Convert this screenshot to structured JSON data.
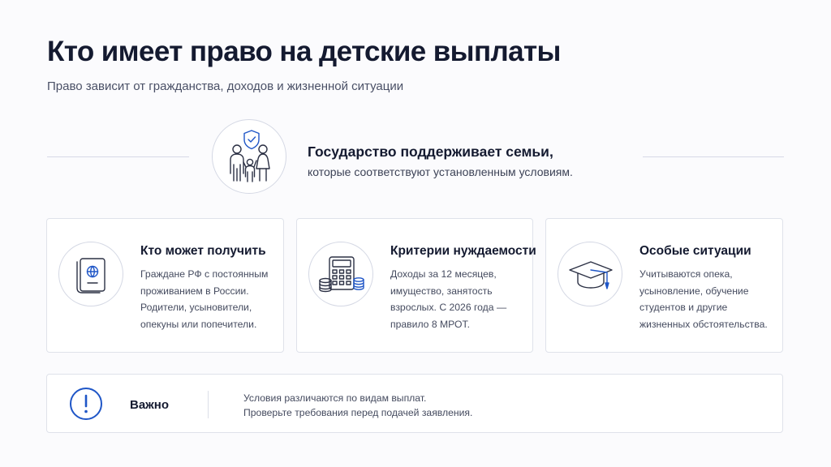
{
  "header": {
    "title": "Кто имеет право на детские выплаты",
    "subtitle": "Право зависит от гражданства, доходов и жизненной ситуации"
  },
  "hero": {
    "icon": "family-shield-icon",
    "title": "Государство поддерживает семьи,",
    "text": "которые соответствуют установленным условиям."
  },
  "cards": [
    {
      "icon": "passport-icon",
      "title": "Кто может получить",
      "lines": [
        "Граждане РФ с постоянным",
        "проживанием в России.",
        "Родители, усыновители,",
        "опекуны или попечители."
      ]
    },
    {
      "icon": "calculator-coins-icon",
      "title": "Критерии нуждаемости",
      "lines": [
        "Доходы за 12 месяцев,",
        "имущество, занятость",
        "взрослых. С 2026 года —",
        "правило 8 МРОТ."
      ]
    },
    {
      "icon": "graduation-cap-icon",
      "title": "Особые ситуации",
      "lines": [
        "Учитываются опека,",
        "усыновление, обучение",
        "студентов и другие",
        "жизненных обстоятельства."
      ]
    }
  ],
  "notice": {
    "icon": "exclamation-icon",
    "label": "Важно",
    "lines": [
      "Условия различаются по видам выплат.",
      "Проверьте требования перед подачей заявления."
    ]
  },
  "colors": {
    "accent": "#1f56c7",
    "icon_stroke": "#2b3044",
    "text_dark": "#141a30",
    "text_muted": "#454b5f",
    "border": "#dfe2ea"
  }
}
